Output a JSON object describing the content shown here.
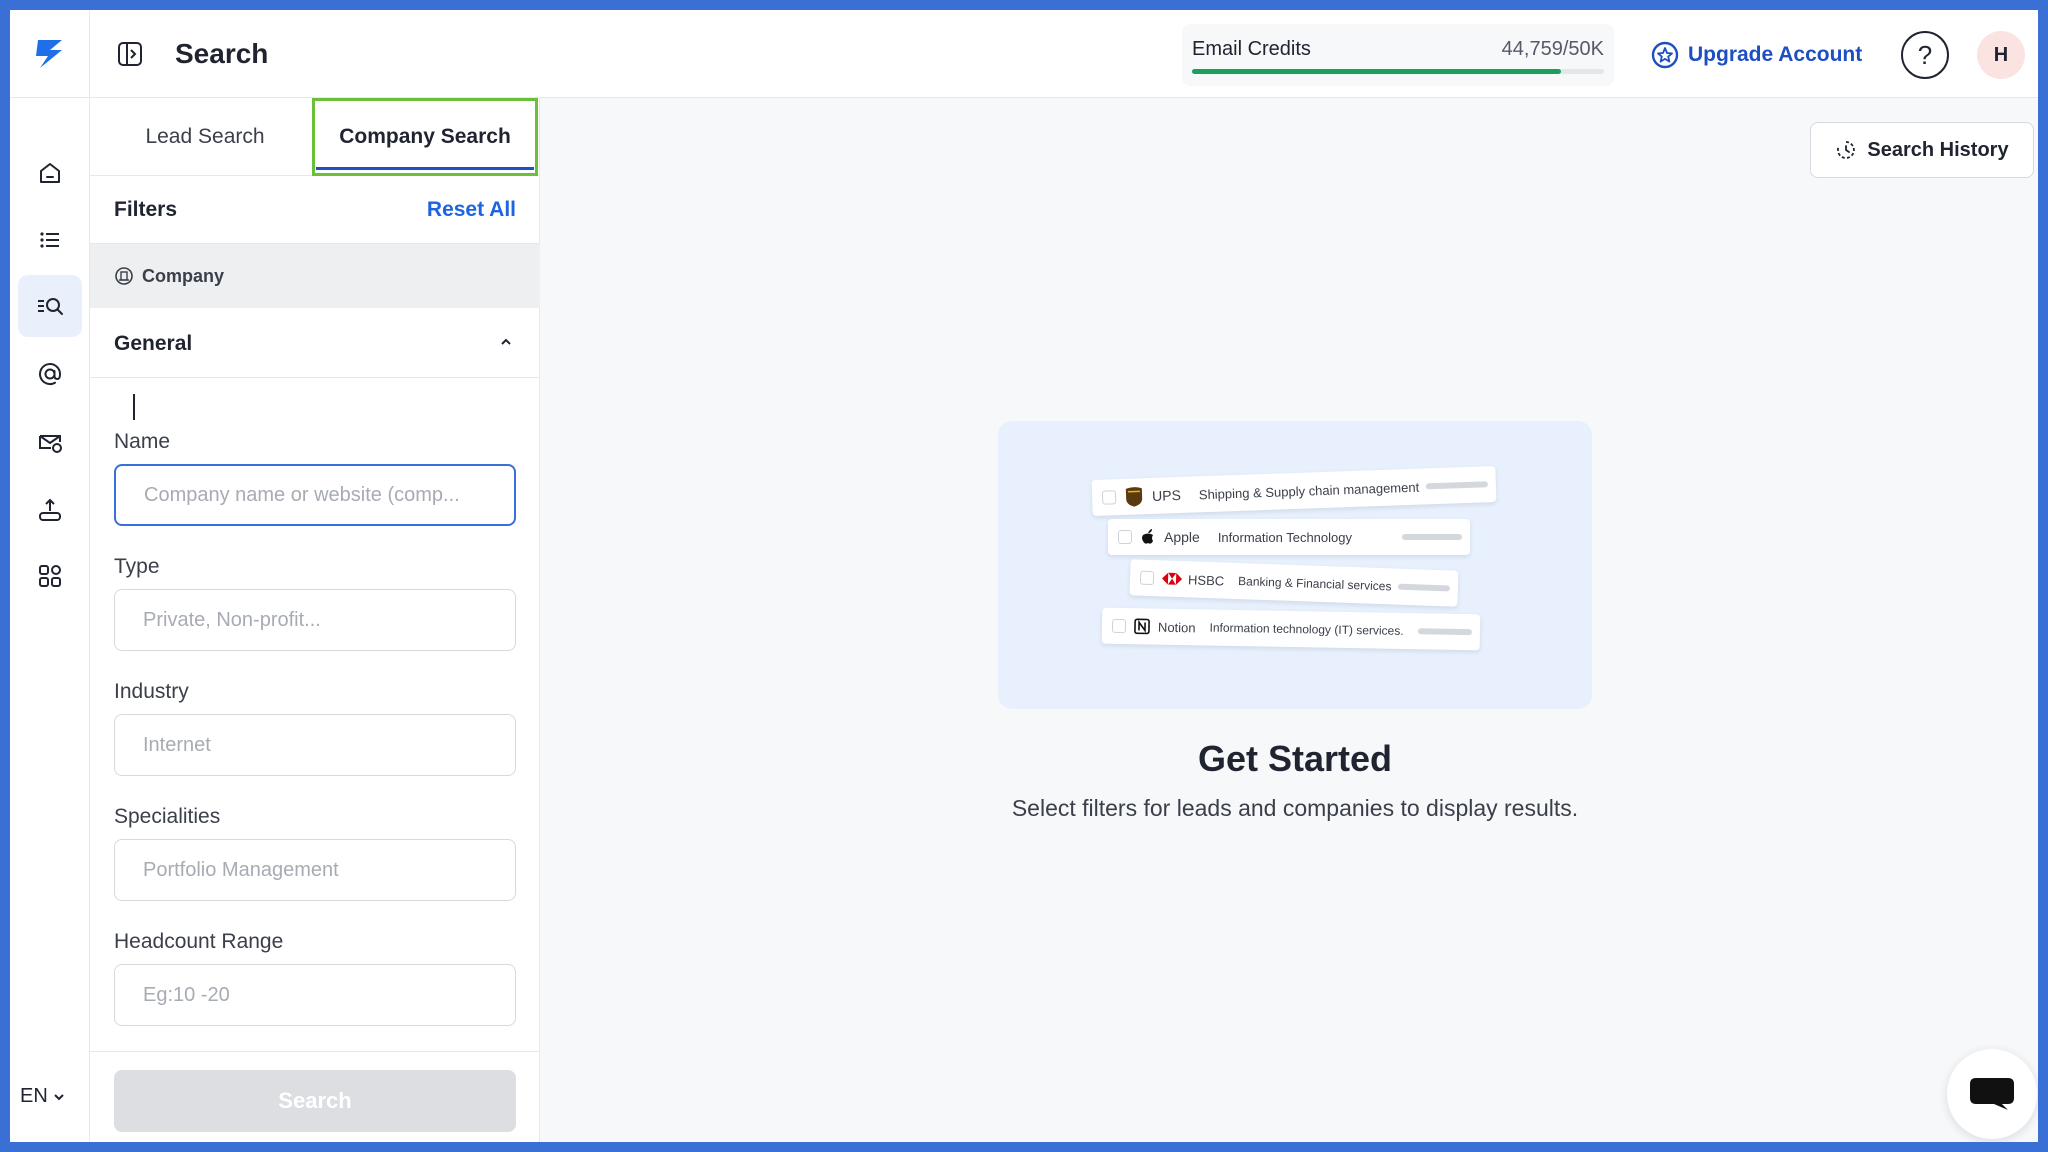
{
  "header": {
    "title": "Search",
    "email_credits_label": "Email Credits",
    "email_credits_value": "44,759/50K",
    "email_credits_fraction": 0.895,
    "upgrade_label": "Upgrade Account",
    "help_label": "?",
    "avatar_initial": "H"
  },
  "sidebar": {
    "items": [
      {
        "icon": "home-icon"
      },
      {
        "icon": "list-icon"
      },
      {
        "icon": "search-list-icon",
        "active": true
      },
      {
        "icon": "at-sign-icon"
      },
      {
        "icon": "mail-settings-icon"
      },
      {
        "icon": "upload-icon"
      },
      {
        "icon": "integrations-icon"
      }
    ],
    "language": "EN"
  },
  "filters": {
    "tabs": [
      {
        "label": "Lead Search",
        "selected": false
      },
      {
        "label": "Company Search",
        "selected": true
      }
    ],
    "title": "Filters",
    "reset_label": "Reset All",
    "section_label": "Company",
    "group_label": "General",
    "fields": [
      {
        "label": "Name",
        "placeholder": "Company name or website (comp..."
      },
      {
        "label": "Type",
        "placeholder": "Private, Non-profit..."
      },
      {
        "label": "Industry",
        "placeholder": "Internet"
      },
      {
        "label": "Specialities",
        "placeholder": "Portfolio Management"
      },
      {
        "label": "Headcount Range",
        "placeholder": "Eg:10 -20"
      }
    ],
    "search_label": "Search"
  },
  "main": {
    "history_label": "Search History",
    "illustration_rows": [
      {
        "company": "UPS",
        "industry": "Shipping & Supply chain management"
      },
      {
        "company": "Apple",
        "industry": "Information Technology"
      },
      {
        "company": "HSBC",
        "industry": "Banking & Financial services"
      },
      {
        "company": "Notion",
        "industry": "Information technology (IT) services."
      }
    ],
    "heading": "Get Started",
    "subtitle": "Select filters for leads and companies to display results."
  },
  "colors": {
    "brand_blue": "#1e4fc2",
    "link_blue": "#1e64e0",
    "progress_green": "#1d9e5c",
    "tab_highlight": "#6cbf3a"
  }
}
